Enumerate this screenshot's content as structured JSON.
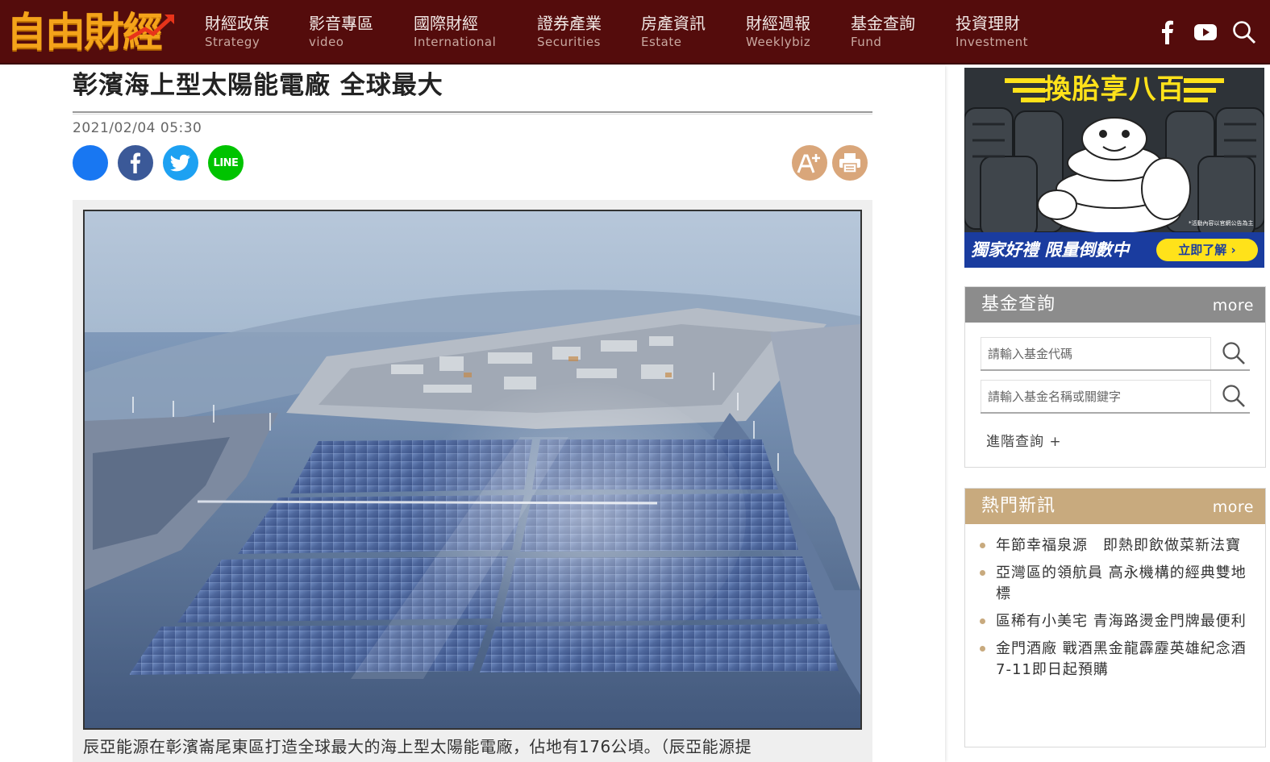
{
  "site": {
    "logo_text": "自由財經"
  },
  "nav": {
    "items": [
      {
        "zh": "財經政策",
        "en": "Strategy"
      },
      {
        "zh": "影音專區",
        "en": "video"
      },
      {
        "zh": "國際財經",
        "en": "International"
      },
      {
        "zh": "證券產業",
        "en": "Securities"
      },
      {
        "zh": "房產資訊",
        "en": "Estate"
      },
      {
        "zh": "財經週報",
        "en": "Weeklybiz"
      },
      {
        "zh": "基金查詢",
        "en": "Fund"
      },
      {
        "zh": "投資理財",
        "en": "Investment"
      }
    ],
    "icons": [
      "facebook-icon",
      "youtube-icon",
      "search-icon"
    ]
  },
  "article": {
    "title": "彰濱海上型太陽能電廠 全球最大",
    "date": "2021/02/04 05:30",
    "share_icons": [
      "share-icon",
      "facebook-icon",
      "twitter-icon",
      "line-icon"
    ],
    "line_label": "LINE",
    "tool_icons": [
      "font-size-icon",
      "print-icon"
    ],
    "caption": "辰亞能源在彰濱崙尾東區打造全球最大的海上型太陽能電廠，佔地有176公頃。（辰亞能源提"
  },
  "ad": {
    "title": "換胎享八百",
    "slogan": "獨家好禮 限量倒數中",
    "cta": "立即了解 ›",
    "fine_print": "*活動內容以官網公告為主"
  },
  "fund_search": {
    "title": "基金查詢",
    "more": "more",
    "code_placeholder": "請輸入基金代碼",
    "name_placeholder": "請輸入基金名稱或關鍵字",
    "advanced": "進階查詢 +"
  },
  "hot_news": {
    "title": "熱門新訊",
    "more": "more",
    "items": [
      "年節幸福泉源　即熱即飲做菜新法寶",
      "亞灣區的領航員 高永機構的經典雙地標",
      "區稀有小美宅 青海路燙金門牌最便利",
      "金門酒廠 戰酒黑金龍霹靂英雄紀念酒 7-11即日起預購"
    ]
  },
  "colors": {
    "nav_bg": "#540c0c",
    "logo": "#f4a31a",
    "accent_gold": "#c8aa7e",
    "fund_header": "#8c8c8c",
    "ad_blue": "#1a3c9f",
    "ad_yellow": "#ffe21a"
  }
}
